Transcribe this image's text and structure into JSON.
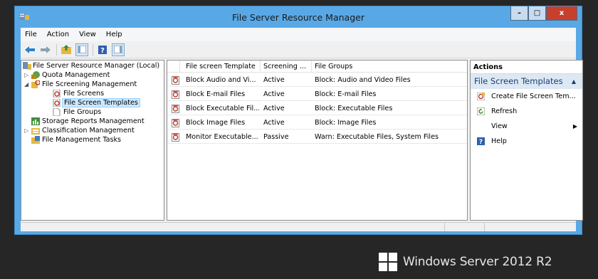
{
  "window": {
    "title": "File Server Resource Manager",
    "minimize": "–",
    "maximize": "□",
    "close": "x"
  },
  "menu": [
    "File",
    "Action",
    "View",
    "Help"
  ],
  "tree": {
    "root": "File Server Resource Manager (Local)",
    "quota": "Quota Management",
    "screening": "File Screening Management",
    "file_screens": "File Screens",
    "file_screen_templates": "File Screen Templates",
    "file_groups": "File Groups",
    "storage_reports": "Storage Reports Management",
    "classification": "Classification Management",
    "file_mgmt_tasks": "File Management Tasks"
  },
  "list": {
    "columns": [
      "File screen Template",
      "Screening ...",
      "File Groups"
    ],
    "rows": [
      {
        "template": "Block Audio and Vi...",
        "screening": "Active",
        "groups": "Block: Audio and Video Files"
      },
      {
        "template": "Block E-mail Files",
        "screening": "Active",
        "groups": "Block: E-mail Files"
      },
      {
        "template": "Block Executable Fil...",
        "screening": "Active",
        "groups": "Block: Executable Files"
      },
      {
        "template": "Block Image Files",
        "screening": "Active",
        "groups": "Block: Image Files"
      },
      {
        "template": "Monitor Executable...",
        "screening": "Passive",
        "groups": "Warn: Executable Files, System Files"
      }
    ]
  },
  "actions": {
    "title": "Actions",
    "section": "File Screen Templates",
    "items": [
      {
        "label": "Create File Screen Tem...",
        "icon": "create-template-icon"
      },
      {
        "label": "Refresh",
        "icon": "refresh-icon"
      },
      {
        "label": "View",
        "icon": "",
        "submenu": true
      },
      {
        "label": "Help",
        "icon": "help-icon"
      }
    ]
  },
  "branding": {
    "text": "Windows Server 2012 R2"
  }
}
